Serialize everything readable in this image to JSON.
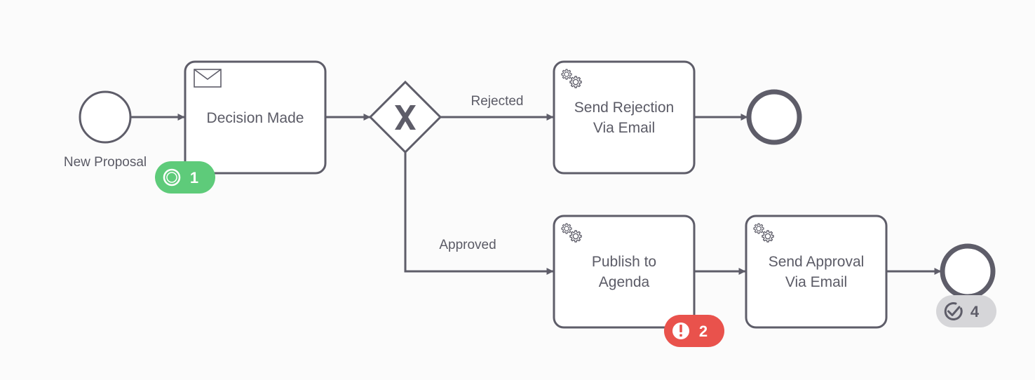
{
  "colors": {
    "stroke": "#5e5d69",
    "text": "#5b5b66",
    "background": "#fbfbfb",
    "task_fill": "#ffffff",
    "badge_active": "#5ecb7a",
    "badge_incident": "#e9524c",
    "badge_completed": "#d6d6d9",
    "badge_completed_text": "#5e5d69"
  },
  "events": {
    "start": {
      "label": "New Proposal",
      "type": "start-event"
    },
    "end_rejected": {
      "label": "",
      "type": "end-event"
    },
    "end_approved": {
      "label": "",
      "type": "end-event"
    }
  },
  "tasks": {
    "decision_made": {
      "lines": [
        "Decision Made"
      ],
      "type": "receive-task",
      "icon": "envelope-icon"
    },
    "send_rejection": {
      "lines": [
        "Send Rejection",
        "Via Email"
      ],
      "type": "service-task",
      "icon": "gears-icon"
    },
    "publish_agenda": {
      "lines": [
        "Publish to",
        "Agenda"
      ],
      "type": "service-task",
      "icon": "gears-icon"
    },
    "send_approval": {
      "lines": [
        "Send Approval",
        "Via Email"
      ],
      "type": "service-task",
      "icon": "gears-icon"
    }
  },
  "gateway": {
    "type": "exclusive-gateway",
    "marker": "X"
  },
  "flows": {
    "rejected": {
      "label": "Rejected"
    },
    "approved": {
      "label": "Approved"
    }
  },
  "badges": {
    "active": {
      "count": "1",
      "icon": "active-instance-icon"
    },
    "incidents": {
      "count": "2",
      "icon": "incident-icon"
    },
    "completed": {
      "count": "4",
      "icon": "completed-check-icon"
    }
  }
}
